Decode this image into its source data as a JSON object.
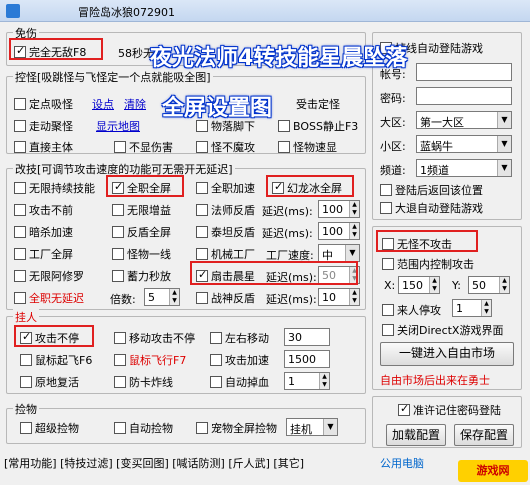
{
  "window": {
    "title": "冒险岛冰狼072901"
  },
  "overlay": {
    "line1": "夜光法师4转技能星晨坠落",
    "line2": "全屏设置图"
  },
  "mianshang": {
    "title": "免伤",
    "invincible": "完全无敌F8",
    "seconds_label": "58秒无敌"
  },
  "control": {
    "title": "控怪[吸跳怪与飞怪定一个点就能吸全图]",
    "fix_pull": "定点吸怪",
    "set_point": "设点",
    "clear": "清除",
    "walk_pull": "走动聚怪",
    "show_map": "显示地图",
    "direct_body": "直接主体",
    "no_damage": "不显伤害",
    "fly_move": "受击定怪",
    "drop_items": "物落脚下",
    "boss_still": "BOSS静止F3",
    "no_magic": "怪不魔攻",
    "monster_slow": "怪物速显"
  },
  "gai": {
    "title": "改技[可调节攻击速度的功能可无需开无延迟]",
    "r1": [
      "无限持续技能",
      "全职全屏",
      "全职加速",
      "幻龙冰全屏"
    ],
    "r2": [
      "攻击不前",
      "无限增益",
      "法师反盾"
    ],
    "r3": [
      "暗杀加速",
      "反盾全屏",
      "泰坦反盾"
    ],
    "r4": [
      "工厂全屏",
      "怪物一线",
      "机械工厂"
    ],
    "r5": [
      "无限阿修罗",
      "蓄力秒放",
      "扇击晨星"
    ],
    "r6_label": "全职无延迟",
    "r6_mult": "倍数:",
    "r6_mult_val": "5",
    "r6_cb": "战神反盾",
    "delay_label": "延迟(ms):",
    "d1": "100",
    "d2": "100",
    "d3": "50",
    "d4": "10",
    "factory_speed": "工厂速度:",
    "factory_val": "中"
  },
  "gua": {
    "title": "挂人",
    "attack_nonstop": "攻击不停",
    "move_attack": "移动攻击不停",
    "left_right": "左右移动",
    "lr_val": "30",
    "mouse_fly": "鼠标起飞F6",
    "mouse_fly2": "鼠标飞行F7",
    "attack_speed": "攻击加速",
    "as_val": "1500",
    "revive": "原地复活",
    "anti_disconnect": "防卡炸线",
    "auto_drop": "自动掉血",
    "ad_val": "1"
  },
  "pickup": {
    "title": "捡物",
    "super": "超级捡物",
    "auto": "自动捡物",
    "pet": "宠物全屏捡物",
    "mode": "挂机"
  },
  "login": {
    "auto_login": "掉线自动登陆游戏",
    "account": "帐号:",
    "password": "密码:",
    "region": "大区:",
    "region_val": "第一大区",
    "zone": "小区:",
    "zone_val": "蓝蜗牛",
    "channel": "频道:",
    "channel_val": "1频道",
    "back_pos": "登陆后返回该位置",
    "auto_enter": "大退自动登陆游戏"
  },
  "right2": {
    "no_attack": "无怪不攻击",
    "range_ctrl": "范围内控制攻击",
    "x_label": "X:",
    "x_val": "150",
    "y_label": "Y:",
    "y_val": "50",
    "someone_stop": "来人停攻",
    "someone_val": "1",
    "close_dx": "关闭DirectX游戏界面",
    "free_market": "一键进入自由市场",
    "notice": "自由市场后出来在勇士"
  },
  "save": {
    "remember": "准许记住密码登陆",
    "load": "加载配置",
    "save": "保存配置",
    "footer": "公用电脑"
  },
  "status": "[常用功能] [特技过滤] [变买回图] [喊话防测] [斤人武] [其它]",
  "watermark": "游戏网"
}
